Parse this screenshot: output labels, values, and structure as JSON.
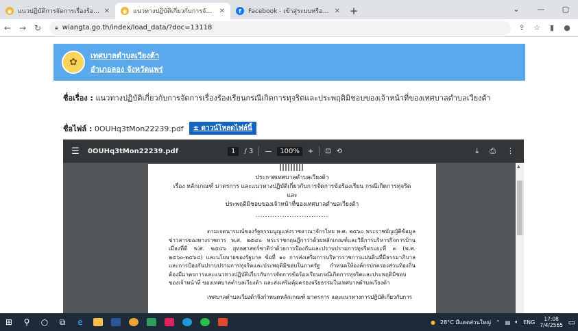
{
  "browser": {
    "tabs": [
      {
        "title": "แนวปฏิบัติการจัดการเรื่องร้องเรียนการ",
        "active": false,
        "favicon_color": "#f2b53a"
      },
      {
        "title": "แนวทางปฏิบัติเกี่ยวกับการจัดการเรื่องร้",
        "active": true,
        "favicon_color": "#f2b53a"
      },
      {
        "title": "Facebook - เข้าสู่ระบบหรือสมัครใช้งาน",
        "active": false,
        "favicon_color": "#1877f2"
      }
    ],
    "url": "wiangta.go.th/index/load_data/?doc=13118"
  },
  "site": {
    "org_line1": "เทศบาลตำบลเวียงต้า",
    "org_line2": "อำเภอลอง จังหวัดแพร่"
  },
  "document": {
    "subject_label": "ชื่อเรื่อง :",
    "subject": "แนวทางปฏิบัติเกี่ยวกับการจัดการเรื่องร้องเรียนกรณีเกิดการทุจริตและประพฤติมิชอบของเจ้าหน้าที่ของเทศบาลตำบลเวียงต้า",
    "file_label": "ชื่อไฟล์ :",
    "file_name": "0OUHq3tMon22239.pdf",
    "download_label": "± ดาวน์โหลดไฟล์นี้"
  },
  "pdf_viewer": {
    "file_name": "0OUHq3tMon22239.pdf",
    "page_current": "1",
    "page_total": "/ 3",
    "zoom": "100%",
    "zoom_out": "—",
    "zoom_in": "+"
  },
  "pdf_page": {
    "heading1": "ประกาศเทศบาลตำบลเวียงต้า",
    "heading2": "เรื่อง หลักเกณฑ์ มาตรการ และแนวทางปฏิบัติเกี่ยวกับการจัดการข้อร้องเรียน กรณีเกิดการทุจริตและ",
    "heading3": "ประพฤติมิชอบของเจ้าหน้าที่ของเทศบาลตำบลเวียงต้า",
    "dots": "..............................",
    "para1": "ตามเจตนารมณ์ของรัฐธรรมนูญแห่งราชอาณาจักรไทย พ.ศ. ๒๕๖๐ พระราชบัญญัติข้อมูลข่าวสารของทางราชการ พ.ศ. ๒๕๔๐ พระราชกฤษฎีกาว่าด้วยหลักเกณฑ์และวิธีการบริหารกิจการบ้านเมืองที่ดี พ.ศ. ๒๕๔๖ ยุทธศาสตร์ชาติว่าด้วยการป้องกันและปราบปรามการทุจริตระยะที่ ๓ (พ.ศ. ๒๕๖๐-๒๕๖๔) และนโยบายของรัฐบาล ข้อที่ ๑๐ การส่งเสริมการบริหารราชการแผ่นดินที่มีธรรมาภิบาลและการป้องกันปราบปรามการทุจริตและประพฤติมิชอบในภาครัฐ กำหนดให้องค์กรปกครองส่วนท้องถิ่นต้องมีมาตรการและแนวทางปฏิบัติเกี่ยวกับการจัดการข้อร้องเรียนกรณีเกิดการทุจริตและประพฤติมิชอบของเจ้าหน้าที่ ของเทศบาลตำบลเวียงต้า และส่งเสริมคุ้มครองจริยธรรมในเทศบาลตำบลเวียงต้า",
    "para2": "เทศบาลตำบลเวียงต้าจึงกำหนดหลักเกณฑ์ มาตรการ และแนวทางการปฏิบัติเกี่ยวกับการ"
  },
  "taskbar": {
    "weather": "28°C มีแดดส่วนใหญ่",
    "lang": "ENG",
    "time": "17:08",
    "date": "7/4/2565"
  }
}
